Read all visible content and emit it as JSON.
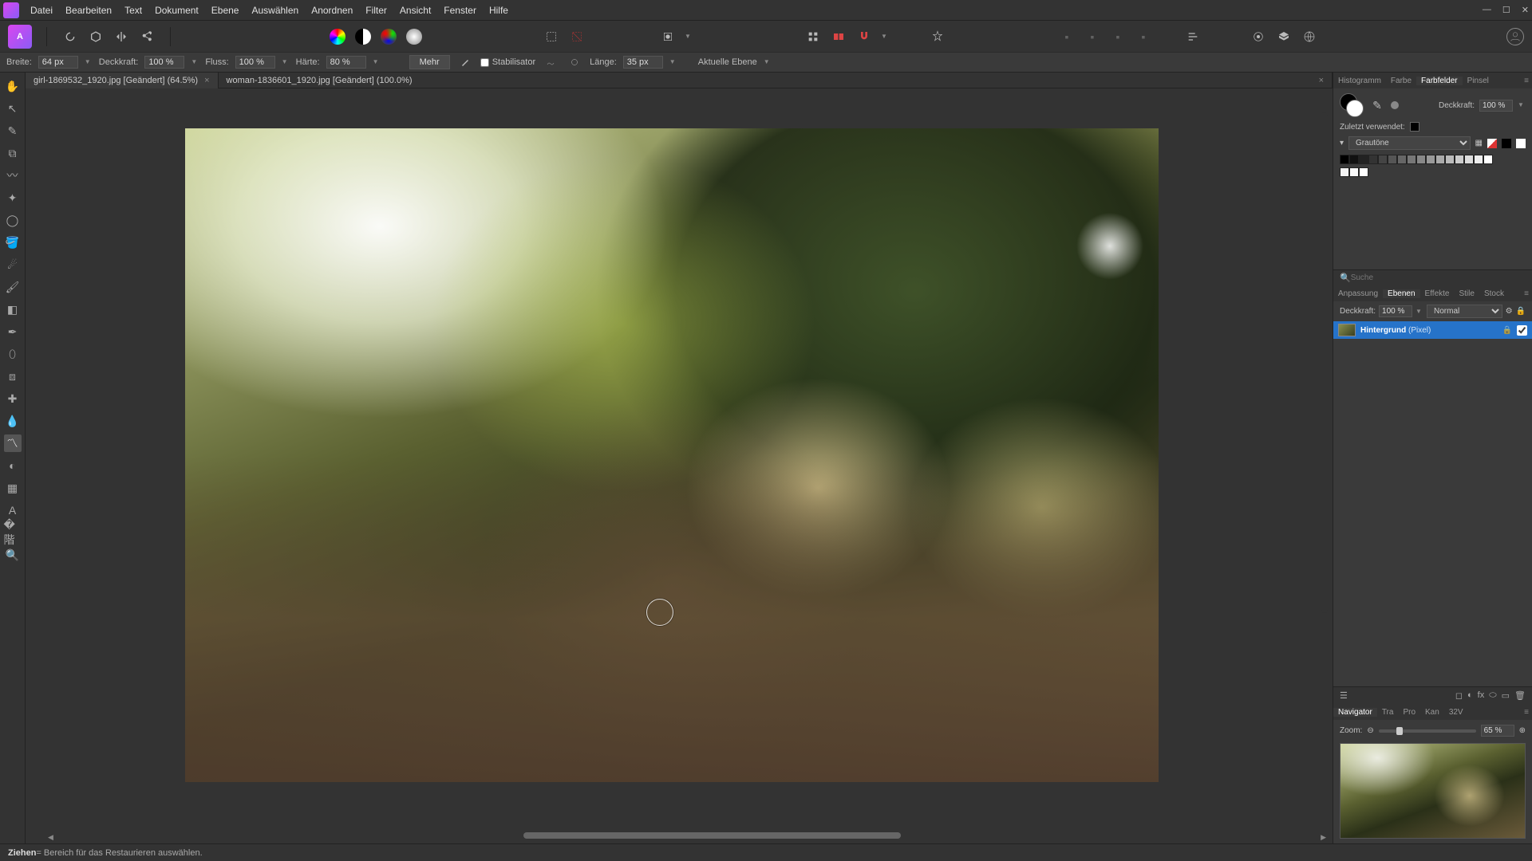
{
  "menu": [
    "Datei",
    "Bearbeiten",
    "Text",
    "Dokument",
    "Ebene",
    "Auswählen",
    "Anordnen",
    "Filter",
    "Ansicht",
    "Fenster",
    "Hilfe"
  ],
  "ctx": {
    "width_label": "Breite:",
    "width_val": "64 px",
    "opacity_label": "Deckkraft:",
    "opacity_val": "100 %",
    "flow_label": "Fluss:",
    "flow_val": "100 %",
    "hardness_label": "Härte:",
    "hardness_val": "80 %",
    "more": "Mehr",
    "stabiliser": "Stabilisator",
    "length_label": "Länge:",
    "length_val": "35 px",
    "target": "Aktuelle Ebene"
  },
  "tabs": [
    {
      "title": "girl-1869532_1920.jpg [Geändert] (64.5%)",
      "active": true
    },
    {
      "title": "woman-1836601_1920.jpg [Geändert] (100.0%)",
      "active": false
    }
  ],
  "right": {
    "topTabs": [
      "Histogramm",
      "Farbe",
      "Farbfelder",
      "Pinsel"
    ],
    "topActive": "Farbfelder",
    "opacity_label": "Deckkraft:",
    "opacity_val": "100 %",
    "recent_label": "Zuletzt verwendet:",
    "palette_name": "Grautöne",
    "search_placeholder": "Suche",
    "midTabs": [
      "Anpassung",
      "Ebenen",
      "Effekte",
      "Stile",
      "Stock"
    ],
    "midActive": "Ebenen",
    "layer_opacity_label": "Deckkraft:",
    "layer_opacity_val": "100 %",
    "blend_mode": "Normal",
    "layer_name": "Hintergrund",
    "layer_type": "(Pixel)",
    "navTabs": [
      "Navigator",
      "Tra",
      "Pro",
      "Kan",
      "32V"
    ],
    "navActive": "Navigator",
    "zoom_label": "Zoom:",
    "zoom_val": "65 %"
  },
  "status": {
    "action": "Ziehen",
    "hint": " = Bereich für das Restaurieren auswählen."
  }
}
